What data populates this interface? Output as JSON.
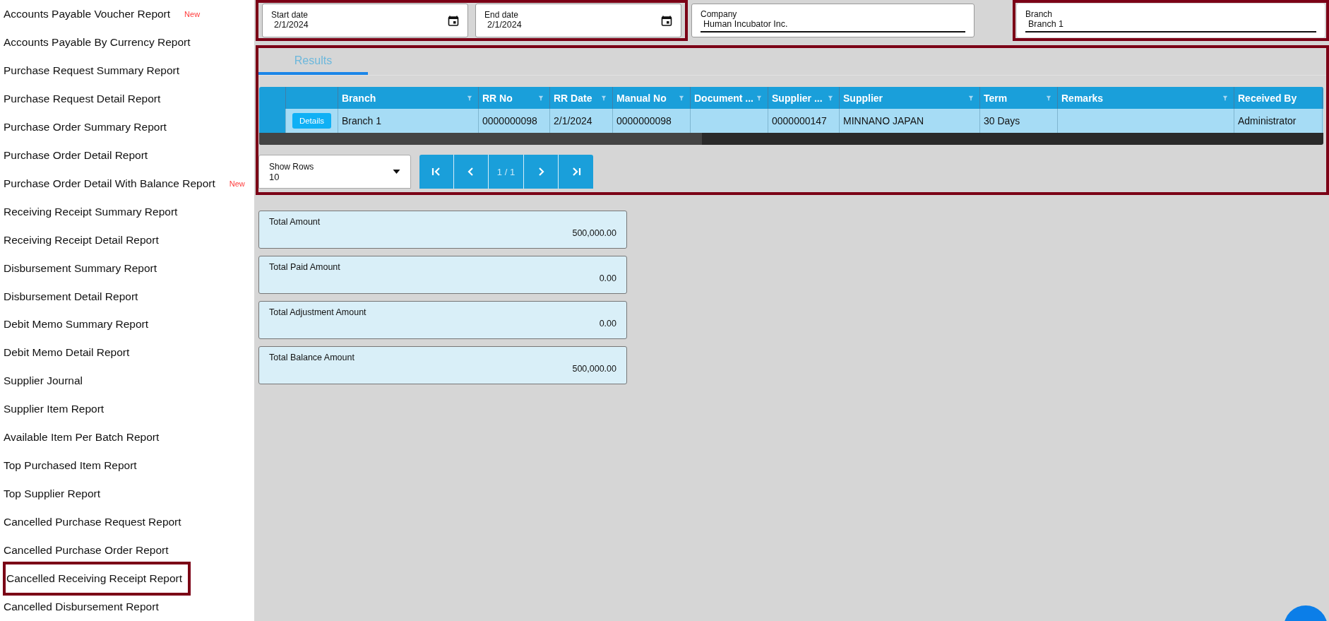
{
  "sidebar": {
    "items": [
      {
        "label": "Accounts Payable Voucher Report",
        "badge": "New",
        "highlighted": false
      },
      {
        "label": "Accounts Payable By Currency Report",
        "highlighted": false
      },
      {
        "label": "Purchase Request Summary Report",
        "highlighted": false
      },
      {
        "label": "Purchase Request Detail Report",
        "highlighted": false
      },
      {
        "label": "Purchase Order Summary Report",
        "highlighted": false
      },
      {
        "label": "Purchase Order Detail Report",
        "highlighted": false
      },
      {
        "label": "Purchase Order Detail With Balance Report",
        "badge": "New",
        "highlighted": false
      },
      {
        "label": "Receiving Receipt Summary Report",
        "highlighted": false
      },
      {
        "label": "Receiving Receipt Detail Report",
        "highlighted": false
      },
      {
        "label": "Disbursement Summary Report",
        "highlighted": false
      },
      {
        "label": "Disbursement Detail Report",
        "highlighted": false
      },
      {
        "label": "Debit Memo Summary Report",
        "highlighted": false
      },
      {
        "label": "Debit Memo Detail Report",
        "highlighted": false
      },
      {
        "label": "Supplier Journal",
        "highlighted": false
      },
      {
        "label": "Supplier Item Report",
        "highlighted": false
      },
      {
        "label": "Available Item Per Batch Report",
        "highlighted": false
      },
      {
        "label": "Top Purchased Item Report",
        "highlighted": false
      },
      {
        "label": "Top Supplier Report",
        "highlighted": false
      },
      {
        "label": "Cancelled Purchase Request Report",
        "highlighted": false
      },
      {
        "label": "Cancelled Purchase Order Report",
        "highlighted": false
      },
      {
        "label": "Cancelled Receiving Receipt Report",
        "highlighted": true
      },
      {
        "label": "Cancelled Disbursement Report",
        "highlighted": false
      }
    ]
  },
  "filter_groups": [
    {
      "highlighted": true,
      "fields": [
        {
          "kind": "date",
          "label": "Start date",
          "value": "2/1/2024"
        },
        {
          "kind": "date",
          "label": "End date",
          "value": "2/1/2024"
        }
      ]
    },
    {
      "highlighted": false,
      "fields": [
        {
          "kind": "text",
          "label": "Company",
          "value": "Human Incubator Inc."
        }
      ]
    },
    {
      "highlighted": true,
      "fields": [
        {
          "kind": "text",
          "label": "Branch",
          "value": "Branch 1"
        }
      ]
    }
  ],
  "results": {
    "highlighted": true,
    "tabs": [
      {
        "label": "Results",
        "selected": true
      }
    ],
    "table": {
      "columns": [
        {
          "label": "Branch",
          "filter": true
        },
        {
          "label": "RR No",
          "filter": true
        },
        {
          "label": "RR Date",
          "filter": true
        },
        {
          "label": "Manual No",
          "filter": true
        },
        {
          "label": "Document ...",
          "filter": true
        },
        {
          "label": "Supplier ...",
          "filter": true
        },
        {
          "label": "Supplier",
          "filter": true
        },
        {
          "label": "Term",
          "filter": true
        },
        {
          "label": "Remarks",
          "filter": true
        },
        {
          "label": "Received By",
          "filter": false
        }
      ],
      "rows": [
        {
          "button": "Details",
          "cells": [
            "Branch 1",
            "0000000098",
            "2/1/2024",
            "0000000098",
            "",
            "0000000147",
            "MINNANO JAPAN",
            "30 Days",
            "",
            "Administrator"
          ]
        }
      ]
    },
    "show_rows": {
      "label": "Show Rows",
      "value": "10"
    },
    "pager": {
      "page": "1 / 1"
    }
  },
  "summary": [
    {
      "label": "Total Amount",
      "value": "500,000.00"
    },
    {
      "label": "Total Paid Amount",
      "value": "0.00"
    },
    {
      "label": "Total Adjustment Amount",
      "value": "0.00"
    },
    {
      "label": "Total Balance Amount",
      "value": "500,000.00"
    }
  ]
}
